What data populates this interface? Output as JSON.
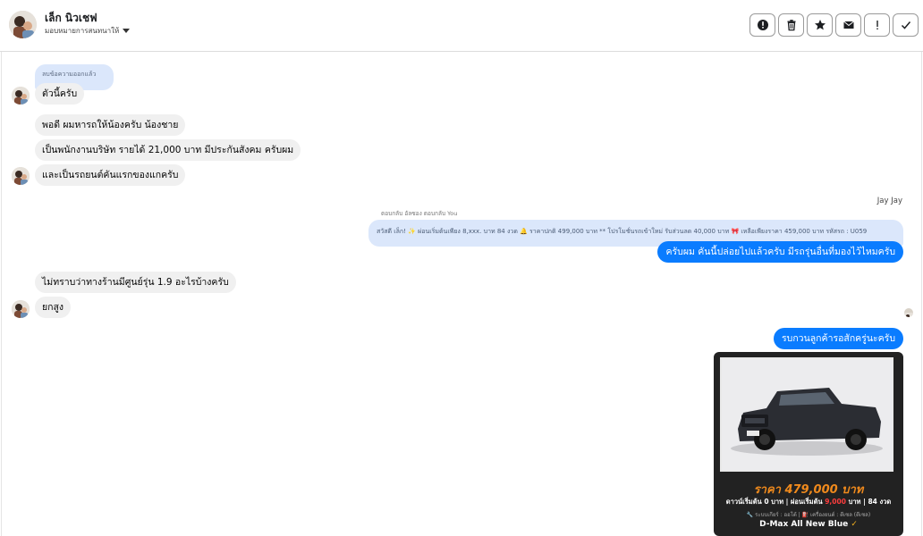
{
  "header": {
    "contact_name": "เล็ก นิวเชฟ",
    "assign_label": "มอบหมายการสนทนาให้"
  },
  "actions": [
    {
      "name": "mark-spam-button",
      "icon": "exclamation-circle-icon"
    },
    {
      "name": "delete-button",
      "icon": "trash-icon"
    },
    {
      "name": "star-button",
      "icon": "star-icon"
    },
    {
      "name": "mark-unread-button",
      "icon": "envelope-icon"
    },
    {
      "name": "follow-up-button",
      "icon": "exclamation-icon"
    },
    {
      "name": "mark-done-button",
      "icon": "check-icon"
    }
  ],
  "messages": {
    "unsent_notice": "ลบข้อความออกแล้ว",
    "m1": "ตัวนี้ครับ",
    "m2": "พอดี ผมหารถให้น้องครับ น้องชาย",
    "m3": "เป็นพนักงานบริษัท รายได้ 21,000 บาท มีประกันสังคม ครับผม",
    "m4": "และเป็นรถยนต์คันแรกของแกครับ",
    "sender_name": "Jay Jay",
    "reply_label": "ตอบกลับ อัลซอง ตอบกลับ You",
    "reply_quote": "สวัสดี เล็ก! ✨ ผ่อนเริ่มต้นเพียง 8,xxx. บาท 84 งวด 🔔 ราคาปกติ 499,000 บาท ** โปรโมชั่นรถเข้าใหม่ รับส่วนลด 40,000 บาท 🎀 เหลือเพียงราคา 459,000 บาท รหัสรถ : U059",
    "m5": "ครับผม คันนี้ปล่อยไปแล้วครับ มีรถรุ่นอื่นที่มองไว้ไหมครับ",
    "m6": "ไม่ทราบว่าทางร้านมีศูนย์รุ่น 1.9 อะไรบ้างครับ",
    "m7": "ยกสูง",
    "m8": "รบกวนลูกค้ารอสักครู่นะครับ"
  },
  "card": {
    "price": "ราคา 479,000 บาท",
    "terms_a": "ดาวน์เริ่มต้น 0 บาท | ผ่อนเริ่มต้น ",
    "terms_b": "9,000",
    "terms_c": " บาท | 84 งวด",
    "spec": "🔧 ระบบเกียร์ : ออโต้ | ⛽ เครื่องยนต์ : ดีเซล (ดีเซล)",
    "model": "D-Max All New Blue",
    "model_check": " ✓"
  },
  "colors": {
    "accent": "#0a7cff",
    "bubble_in": "#f0f0f0",
    "price_orange": "#f08a1c"
  }
}
